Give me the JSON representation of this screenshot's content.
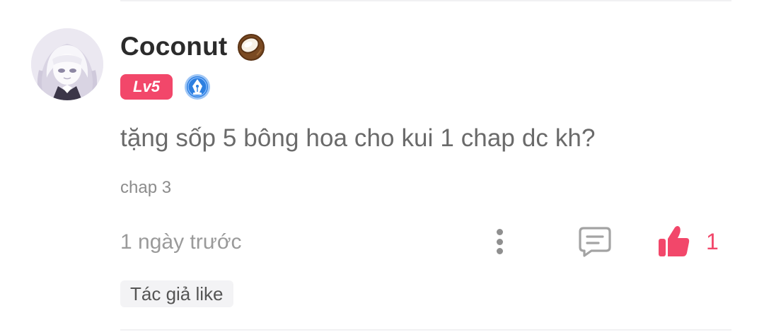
{
  "comment": {
    "user": {
      "name": "Coconut",
      "name_emoji_icon": "coconut-icon",
      "level_badge": "Lv5",
      "extra_badge_icon": "pen-nib-badge-icon",
      "avatar": "anime-character-avatar"
    },
    "text": "tặng sốp 5 bông hoa cho kui 1 chap dc kh?",
    "chapter": "chap 3",
    "timestamp": "1 ngày trước",
    "actions": {
      "more_icon": "more-vertical-icon",
      "reply_icon": "comment-icon",
      "like_icon": "thumbs-up-icon",
      "like_count": "1"
    },
    "author_like_tag": "Tác giả like"
  },
  "colors": {
    "accent": "#f2476a",
    "muted_text": "#9a9a9a",
    "badge_blue": "#2d7fe0"
  }
}
